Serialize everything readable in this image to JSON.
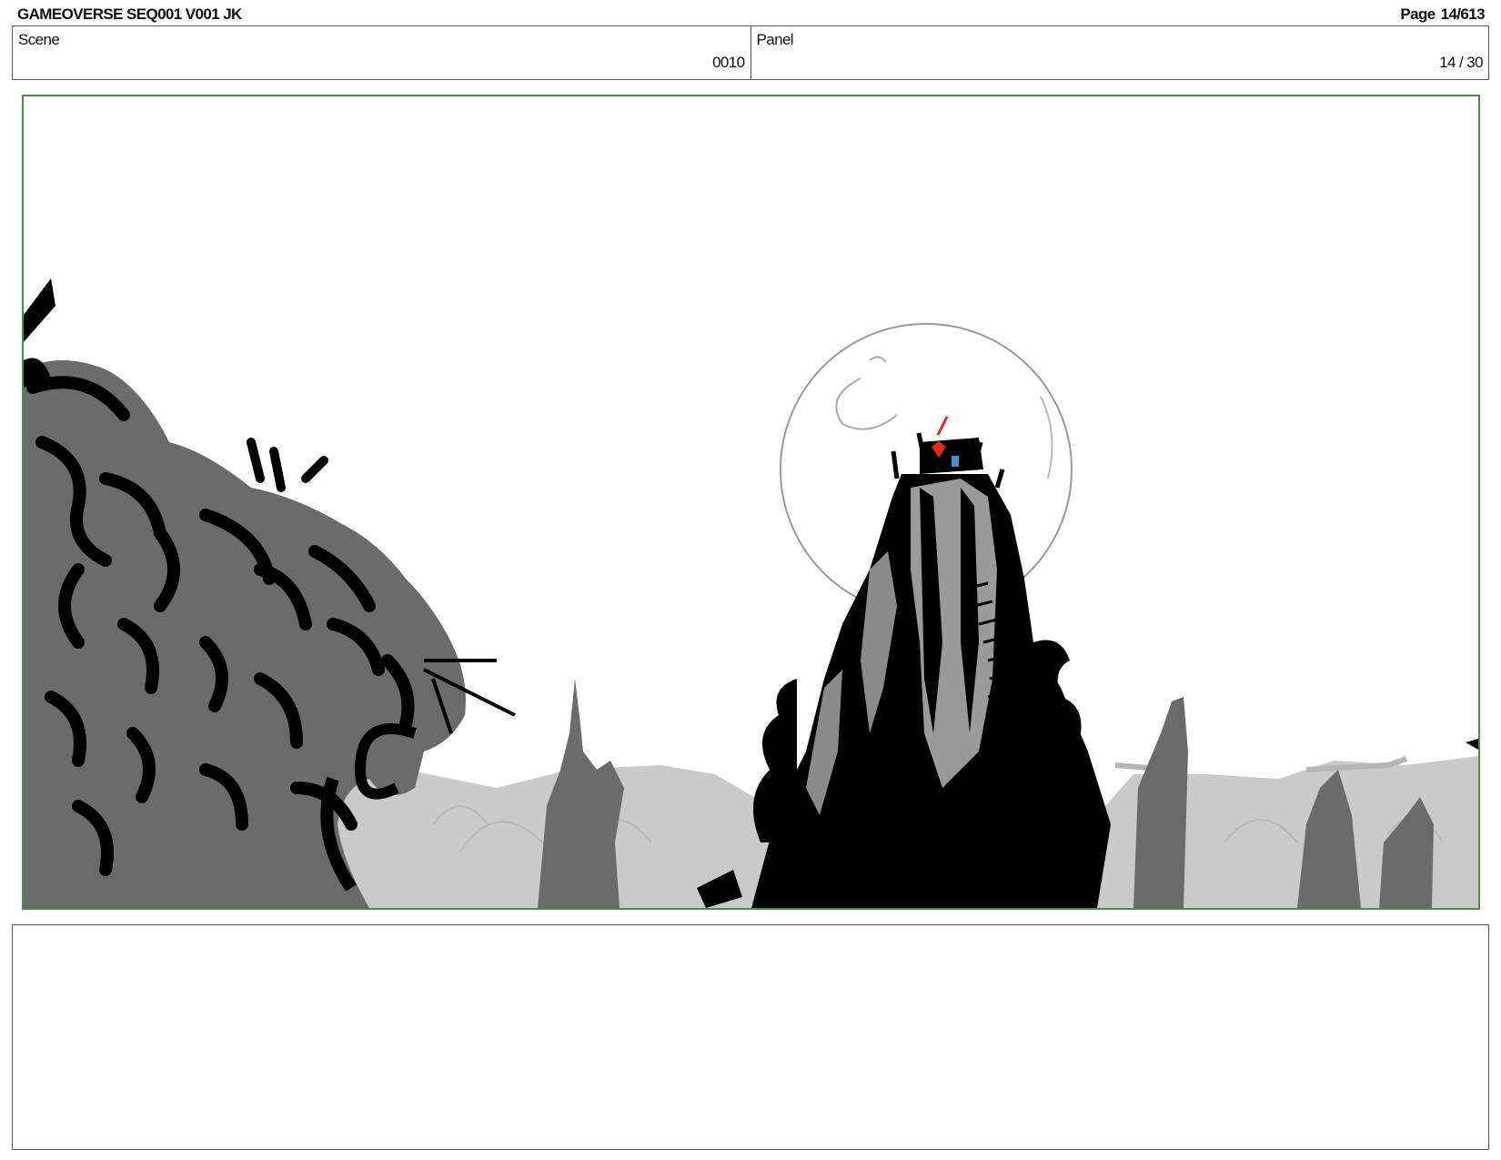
{
  "header": {
    "title": "GAMEOVERSE SEQ001 V001 JK",
    "page_label": "Page",
    "page_value": "14/613"
  },
  "info": {
    "scene_label": "Scene",
    "scene_value": "0010",
    "panel_label": "Panel",
    "panel_value": "14 / 30"
  },
  "artwork": {
    "description_icon": "storyboard-drawing",
    "colors": {
      "frame_border": "#4a8d45",
      "ink": "#000000",
      "mid_gray": "#6b6b6b",
      "light_gray": "#c8c8c8",
      "accent_red": "#e02a1a",
      "accent_blue": "#3a8fd8"
    }
  },
  "notes": {
    "text": ""
  }
}
